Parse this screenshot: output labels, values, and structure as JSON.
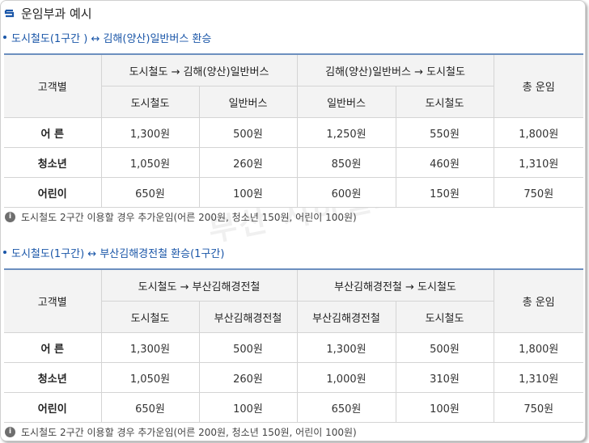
{
  "page_title": "운임부과 예시",
  "watermark_text": "부산 지하철요금",
  "colors": {
    "accent": "#1a56a8",
    "header_bg": "#f3f3f3",
    "border": "#d4d4d4"
  },
  "sections": [
    {
      "heading": "도시철도(1구간 ) ↔ 김해(양산)일반버스 환승",
      "headers": {
        "category": "고객별",
        "group_a": "도시철도 → 김해(양산)일반버스",
        "group_b": "김해(양산)일반버스 → 도시철도",
        "total": "총 운임",
        "a1": "도시철도",
        "a2": "일반버스",
        "b1": "일반버스",
        "b2": "도시철도"
      },
      "rows": [
        {
          "label": "어 른",
          "a1": "1,300원",
          "a2": "500원",
          "b1": "1,250원",
          "b2": "550원",
          "total": "1,800원"
        },
        {
          "label": "청소년",
          "a1": "1,050원",
          "a2": "260원",
          "b1": "850원",
          "b2": "460원",
          "total": "1,310원"
        },
        {
          "label": "어린이",
          "a1": "650원",
          "a2": "100원",
          "b1": "600원",
          "b2": "150원",
          "total": "750원"
        }
      ],
      "note": "도시철도 2구간 이용할 경우 추가운임(어른 200원, 청소년 150원, 어린이 100원)"
    },
    {
      "heading": "도시철도(1구간) ↔ 부산김해경전철 환승(1구간)",
      "headers": {
        "category": "고객별",
        "group_a": "도시철도 → 부산김해경전철",
        "group_b": "부산김해경전철 → 도시철도",
        "total": "총 운임",
        "a1": "도시철도",
        "a2": "부산김해경전철",
        "b1": "부산김해경전철",
        "b2": "도시철도"
      },
      "rows": [
        {
          "label": "어 른",
          "a1": "1,300원",
          "a2": "500원",
          "b1": "1,300원",
          "b2": "500원",
          "total": "1,800원"
        },
        {
          "label": "청소년",
          "a1": "1,050원",
          "a2": "260원",
          "b1": "1,000원",
          "b2": "310원",
          "total": "1,310원"
        },
        {
          "label": "어린이",
          "a1": "650원",
          "a2": "100원",
          "b1": "650원",
          "b2": "100원",
          "total": "750원"
        }
      ],
      "note": "도시철도 2구간 이용할 경우 추가운임(어른 200원, 청소년 150원, 어린이 100원)"
    }
  ]
}
